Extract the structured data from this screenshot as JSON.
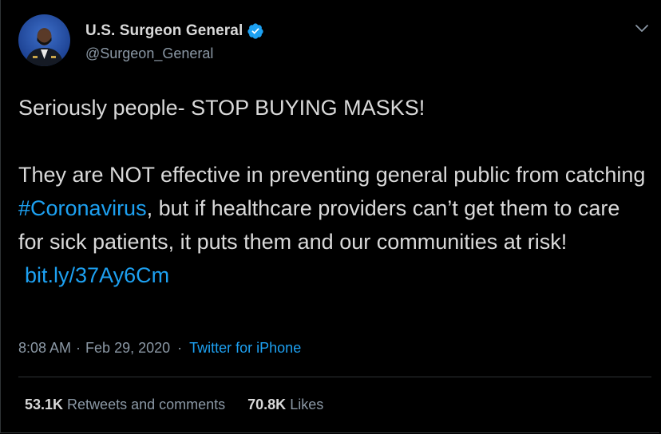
{
  "user": {
    "display_name": "U.S. Surgeon General",
    "handle": "@Surgeon_General",
    "verified_icon": "verified-badge-icon"
  },
  "menu": {
    "icon": "chevron-down-icon"
  },
  "tweet": {
    "line1": "Seriously people- STOP BUYING MASKS!",
    "para2_before_hashtag": "They are NOT effective in preventing general public from catching ",
    "hashtag": "#Coronavirus",
    "para2_after_hashtag": ", but if healthcare providers can’t get them to care for sick patients, it puts them and our communities at risk!",
    "link": "bit.ly/37Ay6Cm"
  },
  "meta": {
    "time": "8:08 AM",
    "separator": "·",
    "date": "Feb 29, 2020",
    "source": "Twitter for iPhone"
  },
  "stats": {
    "retweets_count": "53.1K",
    "retweets_label": "Retweets and comments",
    "likes_count": "70.8K",
    "likes_label": "Likes"
  },
  "colors": {
    "background": "#000000",
    "text": "#d9d9d9",
    "secondary": "#8b98a5",
    "link": "#1da1f2",
    "divider": "#2f3336"
  }
}
